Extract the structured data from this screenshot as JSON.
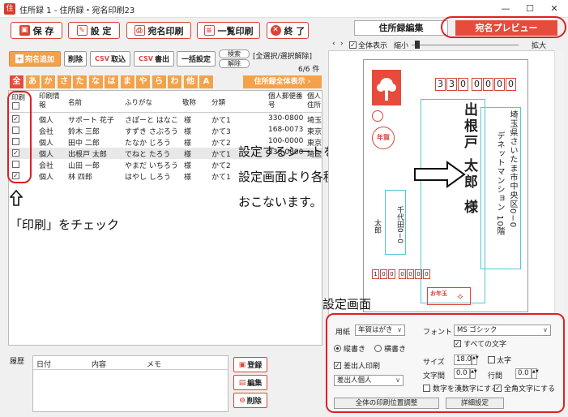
{
  "window": {
    "title": "住所録 1 - 住所録・宛名印刷23",
    "app_icon": "住",
    "minimize": "—",
    "maximize": "☐",
    "close": "✕"
  },
  "toolbar": {
    "save": "保 存",
    "settings": "設 定",
    "print_address": "宛名印刷",
    "print_list": "一覧印刷",
    "exit": "終 了",
    "save_ico": "▣",
    "settings_ico": "✎",
    "print_ico": "⎙",
    "list_ico": "≡",
    "exit_ico": "✕"
  },
  "tabs": {
    "address_edit": "住所録編集",
    "address_preview": "宛名プレビュー"
  },
  "sub_toolbar": {
    "add": "宛名追加",
    "delete": "削除",
    "csv_import": "取込",
    "csv_export": "書出",
    "batch_settings": "一括設定",
    "search": "検索",
    "release": "解除",
    "select_all": "[全選択/選択解除]",
    "count": "6/6 件",
    "csv": "CSV"
  },
  "kana_tabs": [
    "全",
    "あ",
    "か",
    "さ",
    "た",
    "な",
    "は",
    "ま",
    "や",
    "ら",
    "わ",
    "他",
    "A"
  ],
  "show_all": "住所録全体表示 ›",
  "table": {
    "headers": {
      "print": "印刷",
      "print_info": "印刷情報",
      "name": "名前",
      "furigana": "ふりがな",
      "honorific": "敬称",
      "category": "分類",
      "postal": "個人郵便番号",
      "address": "個人住所"
    },
    "rows": [
      {
        "checked": "✓",
        "info": "個人",
        "name": "サポート 花子",
        "furigana": "さぽーと はなこ",
        "honorific": "様",
        "category": "かて1",
        "postal": "330-0800",
        "address": "埼玉"
      },
      {
        "checked": "",
        "info": "会社",
        "name": "鈴木 三郎",
        "furigana": "すずき さぶろう",
        "honorific": "様",
        "category": "かて3",
        "postal": "168-0073",
        "address": "東京"
      },
      {
        "checked": "",
        "info": "個人",
        "name": "田中 二郎",
        "furigana": "たなか じろう",
        "honorific": "様",
        "category": "かて2",
        "postal": "100-0000",
        "address": "東京"
      },
      {
        "checked": "✓",
        "info": "個人",
        "name": "出根戸 太郎",
        "furigana": "でねと たろう",
        "honorific": "様",
        "category": "かて1",
        "postal": "330-0800",
        "address": "埼玉"
      },
      {
        "checked": "",
        "info": "会社",
        "name": "山田 一郎",
        "furigana": "やまだ いちろう",
        "honorific": "様",
        "category": "かて2",
        "postal": "",
        "address": ""
      },
      {
        "checked": "✓",
        "info": "個人",
        "name": "林 四郎",
        "furigana": "はやし しろう",
        "honorific": "様",
        "category": "かて1",
        "postal": "",
        "address": ""
      }
    ]
  },
  "history": {
    "label": "履歴",
    "date": "日付",
    "content": "内容",
    "memo": "メモ",
    "register": "登録",
    "edit": "編集",
    "delete": "削除"
  },
  "preview": {
    "show_all": "全体表示",
    "shrink": "縮小",
    "enlarge": "拡大",
    "postal_code": "3300000",
    "recipient_name": "出根戸 太郎",
    "honorific": "様",
    "address1": "埼玉県さいたま市中央区0−0",
    "address2": "デネットマンション 10階",
    "sender_name": "太郎",
    "sender_address": "千代田0−0",
    "sender_postal": "1000000",
    "otoshidama": "お年玉",
    "nenga": "年賀"
  },
  "settings": {
    "paper_label": "用紙",
    "paper_value": "年賀はがき",
    "font_label": "フォント",
    "font_value": "MS ゴシック",
    "vertical": "縦書き",
    "horizontal": "横書き",
    "all_chars": "すべての文字",
    "sender_print": "差出人印刷",
    "sender_value": "差出人個人",
    "size_label": "サイズ",
    "size_value": "18.0",
    "bold": "太字",
    "char_spacing": "文字間",
    "char_spacing_value": "0.0",
    "line_spacing": "行間",
    "line_spacing_value": "0.0",
    "kanji_numbers": "数字を漢数字にする",
    "fullwidth": "全角文字にする",
    "adjust_all": "全体の印刷位置調整",
    "detail": "詳細設定"
  },
  "annotations": {
    "check_print": "「印刷」をチェック",
    "desc_line1": "設定するシートを選択して",
    "desc_line2": "設定画面より各種設定を",
    "desc_line3": "おこないます。",
    "settings_screen": "設定画面"
  }
}
